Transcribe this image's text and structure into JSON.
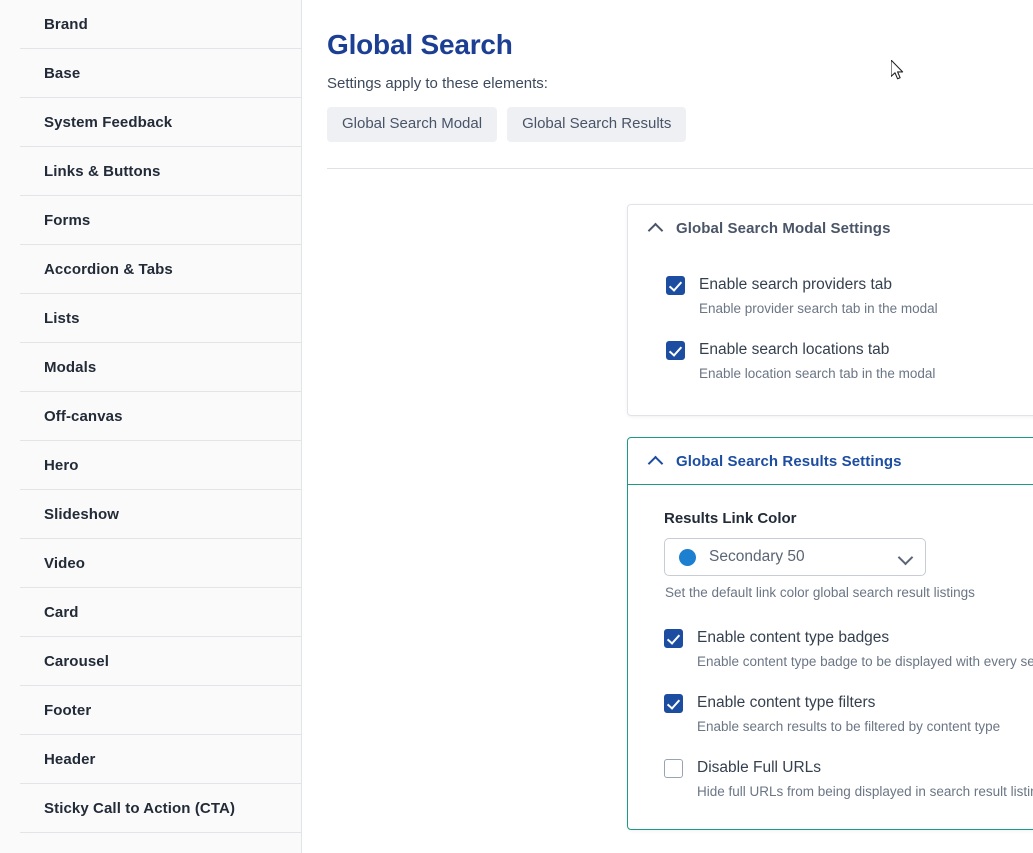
{
  "sidebar": {
    "items": [
      {
        "label": "Brand"
      },
      {
        "label": "Base"
      },
      {
        "label": "System Feedback"
      },
      {
        "label": "Links & Buttons"
      },
      {
        "label": "Forms"
      },
      {
        "label": "Accordion & Tabs"
      },
      {
        "label": "Lists"
      },
      {
        "label": "Modals"
      },
      {
        "label": "Off-canvas"
      },
      {
        "label": "Hero"
      },
      {
        "label": "Slideshow"
      },
      {
        "label": "Video"
      },
      {
        "label": "Card"
      },
      {
        "label": "Carousel"
      },
      {
        "label": "Footer"
      },
      {
        "label": "Header"
      },
      {
        "label": "Sticky Call to Action (CTA)"
      }
    ]
  },
  "header": {
    "title": "Global Search",
    "applies_label": "Settings apply to these elements:",
    "chips": [
      {
        "label": "Global Search Modal"
      },
      {
        "label": "Global Search Results"
      }
    ]
  },
  "modal_panel": {
    "title": "Global Search Modal Settings",
    "checkboxes": [
      {
        "label": "Enable search providers tab",
        "help": "Enable provider search tab in the modal",
        "checked": true
      },
      {
        "label": "Enable search locations tab",
        "help": "Enable location search tab in the modal",
        "checked": true
      }
    ]
  },
  "results_panel": {
    "title": "Global Search Results Settings",
    "link_color_field": {
      "label": "Results Link Color",
      "value": "Secondary 50",
      "swatch_color": "#1c7fd0",
      "help": "Set the default link color global search result listings"
    },
    "checkboxes": [
      {
        "label": "Enable content type badges",
        "help": "Enable content type badge to be displayed with every search result listing",
        "checked": true
      },
      {
        "label": "Enable content type filters",
        "help": "Enable search results to be filtered by content type",
        "checked": true
      },
      {
        "label": "Disable Full URLs",
        "help": "Hide full URLs from being displayed in search result listings",
        "checked": false
      }
    ]
  },
  "colors": {
    "title_blue": "#1c3f94",
    "checkbox_blue": "#1c4da1",
    "results_border_teal": "#1c9a85",
    "chip_bg": "#eef0f4"
  }
}
